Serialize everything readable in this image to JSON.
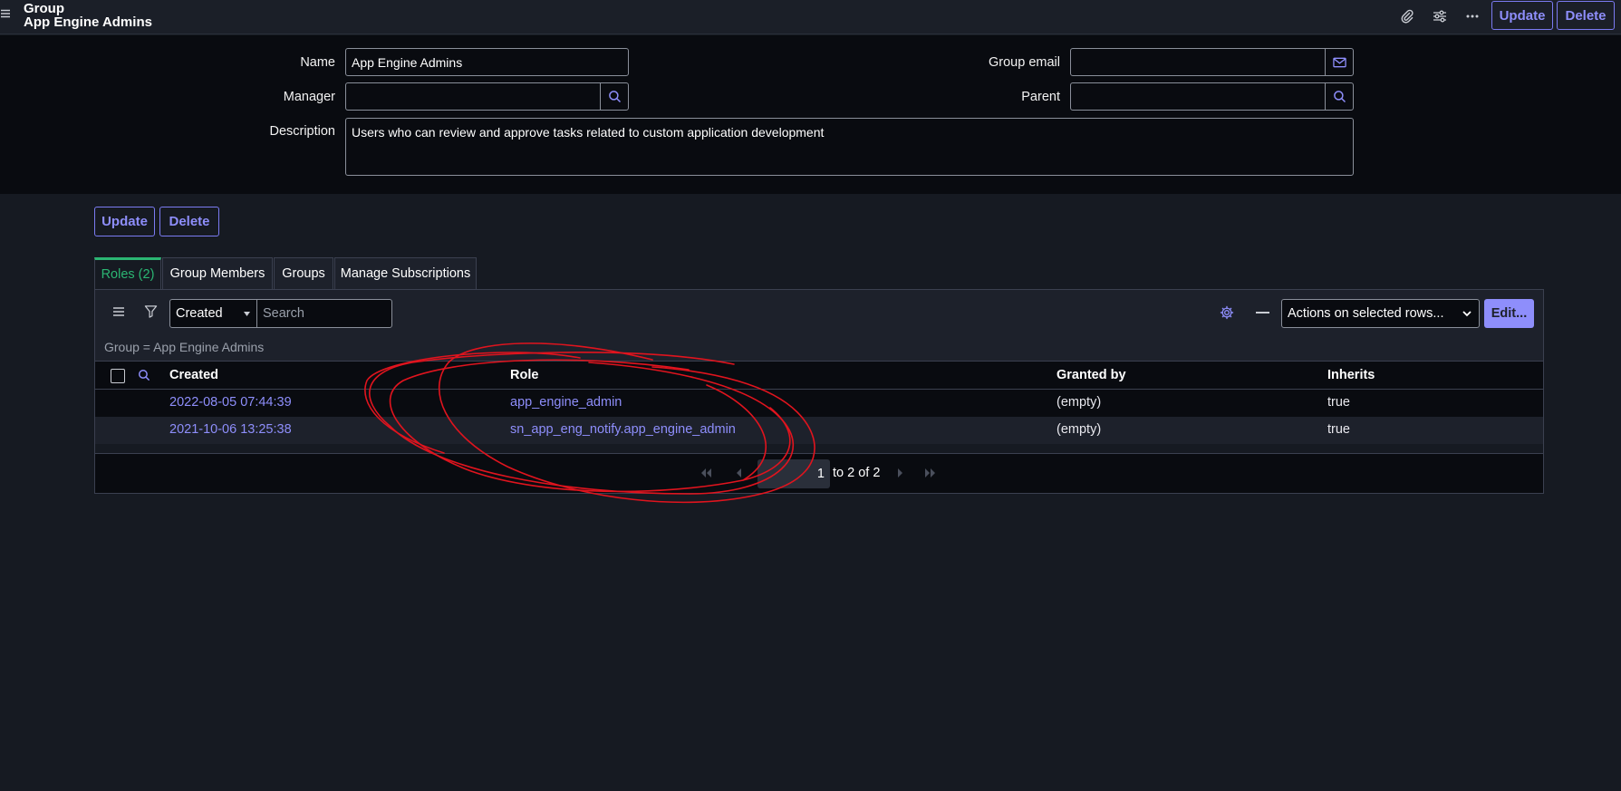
{
  "header": {
    "title_line1": "Group",
    "title_line2": "App Engine Admins",
    "update_label": "Update",
    "delete_label": "Delete",
    "icons": [
      "hamburger-icon",
      "paperclip-icon",
      "sliders-icon",
      "more-icon"
    ]
  },
  "form": {
    "name_label": "Name",
    "name_value": "App Engine Admins",
    "manager_label": "Manager",
    "manager_value": "",
    "description_label": "Description",
    "description_value": "Users who can review and approve tasks related to custom application development",
    "group_email_label": "Group email",
    "group_email_value": "",
    "parent_label": "Parent",
    "parent_value": ""
  },
  "actions": {
    "update_label": "Update",
    "delete_label": "Delete"
  },
  "tabs": [
    {
      "label": "Roles (2)",
      "active": true
    },
    {
      "label": "Group Members",
      "active": false
    },
    {
      "label": "Groups",
      "active": false
    },
    {
      "label": "Manage Subscriptions",
      "active": false
    }
  ],
  "list": {
    "search_field_selected": "Created",
    "search_placeholder": "Search",
    "actions_selected": "Actions on selected rows...",
    "edit_label": "Edit...",
    "breadcrumb": "Group = App Engine Admins",
    "columns": [
      "Created",
      "Role",
      "Granted by",
      "Inherits"
    ],
    "rows": [
      {
        "created": "2022-08-05 07:44:39",
        "role": "app_engine_admin",
        "granted_by": "(empty)",
        "inherits": "true"
      },
      {
        "created": "2021-10-06 13:25:38",
        "role": "sn_app_eng_notify.app_engine_admin",
        "granted_by": "(empty)",
        "inherits": "true"
      }
    ],
    "pagination": {
      "page_input": "1",
      "range_text": "to 2 of 2"
    }
  },
  "colors": {
    "accent": "#8e8efb",
    "active_tab": "#2bb673",
    "annotation": "#e0141e",
    "background": "#161a22"
  }
}
